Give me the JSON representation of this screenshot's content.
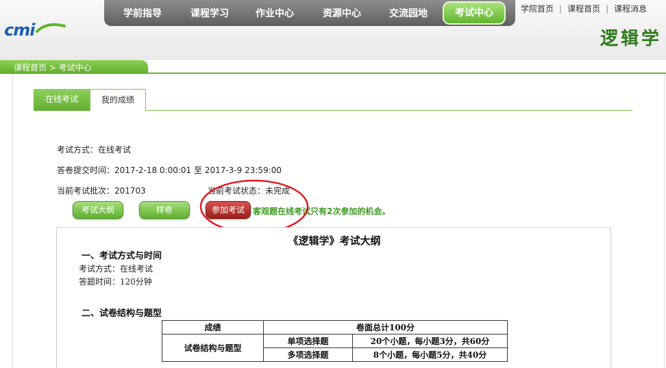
{
  "header": {
    "logo_text": "cmi",
    "course_title": "逻辑学",
    "nav": [
      "学前指导",
      "课程学习",
      "作业中心",
      "资源中心",
      "交流园地",
      "考试中心"
    ],
    "nav_active_index": 5,
    "top_links": [
      "学院首页",
      "课程首页",
      "课程消息"
    ]
  },
  "breadcrumb": "课程首页 > 考试中心",
  "tabs": [
    "在线考试",
    "我的成绩"
  ],
  "exam_info": {
    "method": "考试方式：在线考试",
    "submit_time": "答卷提交时间：2017-2-18 0:00:01 至 2017-3-9 23:59:00",
    "batch": "当前考试批次：201703",
    "status": "当前考试状态：未完成"
  },
  "buttons": {
    "outline": "考试大纲",
    "sample": "样卷",
    "join": "参加考试"
  },
  "notice": "客观题在线考试只有2次参加的机会。",
  "syllabus": {
    "title": "《逻辑学》考试大纲",
    "section1": "一、考试方式与时间",
    "line1": "考试方式：在线考试",
    "line2": "答题时间：120分钟",
    "section2": "二、试卷结构与题型",
    "table": {
      "h_score": "成绩",
      "h_total": "卷面总计100分",
      "row_label": "试卷结构与题型",
      "rows": [
        {
          "type": "单项选择题",
          "detail": "20个小题，每小题3分，共60分"
        },
        {
          "type": "多项选择题",
          "detail": "8个小题，每小题5分，共40分"
        }
      ]
    }
  },
  "colors": {
    "accent_green": "#62ae31",
    "join_red": "#9b1d1a",
    "annotation_red": "#e0191f"
  }
}
